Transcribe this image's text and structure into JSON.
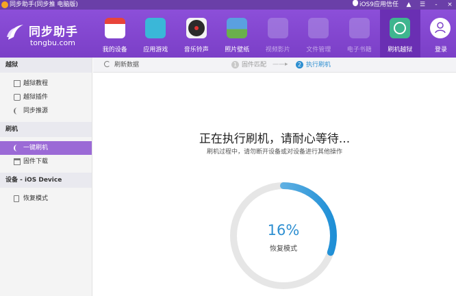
{
  "window": {
    "title": "同步助手(同步推 电脑版)",
    "trust_label": "iOS9应用信任",
    "buttons": [
      "-",
      "×"
    ]
  },
  "logo": {
    "name": "同步助手",
    "domain": "tongbu.com"
  },
  "nav": [
    {
      "label": "我的设备",
      "icon": "store-icon",
      "color": "#e8443a"
    },
    {
      "label": "应用游戏",
      "icon": "app-store-icon",
      "color": "#3ab7d8"
    },
    {
      "label": "音乐铃声",
      "icon": "music-disc-icon",
      "color": "#2b2b2b"
    },
    {
      "label": "照片壁纸",
      "icon": "photo-icon",
      "color": "#6ab04c"
    },
    {
      "label": "视频影片",
      "icon": "video-clapper-icon",
      "color": "#9b7ad8"
    },
    {
      "label": "文件管理",
      "icon": "folder-icon",
      "color": "#9b7ad8"
    },
    {
      "label": "电子书籍",
      "icon": "book-icon",
      "color": "#9b7ad8"
    },
    {
      "label": "刷机越狱",
      "icon": "jailbreak-icon",
      "color": "#3fb58f"
    }
  ],
  "login": {
    "label": "登录"
  },
  "sidebar": {
    "sections": [
      {
        "title": "越狱",
        "items": [
          {
            "label": "越狱教程",
            "icon": "tutorial-icon"
          },
          {
            "label": "越狱插件",
            "icon": "plugin-icon"
          },
          {
            "label": "同步推源",
            "icon": "source-icon"
          }
        ]
      },
      {
        "title": "刷机",
        "items": [
          {
            "label": "一键刷机",
            "icon": "flash-icon"
          },
          {
            "label": "固件下载",
            "icon": "firmware-download-icon"
          }
        ]
      },
      {
        "title": "设备 - iOS Device",
        "items": [
          {
            "label": "恢复模式",
            "icon": "recovery-icon"
          }
        ]
      }
    ]
  },
  "main": {
    "refresh_label": "刷新数据",
    "steps": [
      {
        "num": "1",
        "label": "固件匹配"
      },
      {
        "num": "2",
        "label": "执行刷机"
      }
    ],
    "step_separator": "——▸",
    "heading": "正在执行刷机，请耐心等待...",
    "subtext": "刷机过程中，请勿断开设备或对设备进行其他操作",
    "progress_fraction": 0.16,
    "progress_text": "16%",
    "mode_label": "恢复模式"
  }
}
